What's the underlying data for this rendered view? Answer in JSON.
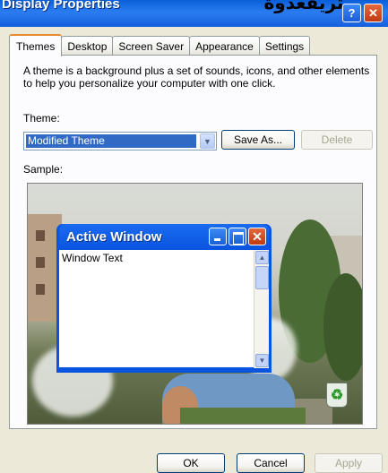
{
  "window": {
    "title": "Display Properties",
    "overlay_text": "تريقعدوة.",
    "help_label": "?",
    "close_label": "✕"
  },
  "tabs": [
    {
      "label": "Themes",
      "active": true
    },
    {
      "label": "Desktop",
      "active": false
    },
    {
      "label": "Screen Saver",
      "active": false
    },
    {
      "label": "Appearance",
      "active": false
    },
    {
      "label": "Settings",
      "active": false
    }
  ],
  "themes": {
    "description": "A theme is a background plus a set of sounds, icons, and other elements to help you personalize your computer with one click.",
    "theme_label": "Theme:",
    "selected_theme": "Modified Theme",
    "save_as_label": "Save As...",
    "delete_label": "Delete",
    "sample_label": "Sample:"
  },
  "preview": {
    "window_title": "Active Window",
    "window_text": "Window Text",
    "close_glyph": "✕",
    "recycle_icon": "recycle-bin-icon"
  },
  "footer": {
    "ok_label": "OK",
    "cancel_label": "Cancel",
    "apply_label": "Apply"
  },
  "colors": {
    "titlebar": "#0a55e0",
    "selection": "#316ac5",
    "tab_highlight": "#e68b2c"
  }
}
